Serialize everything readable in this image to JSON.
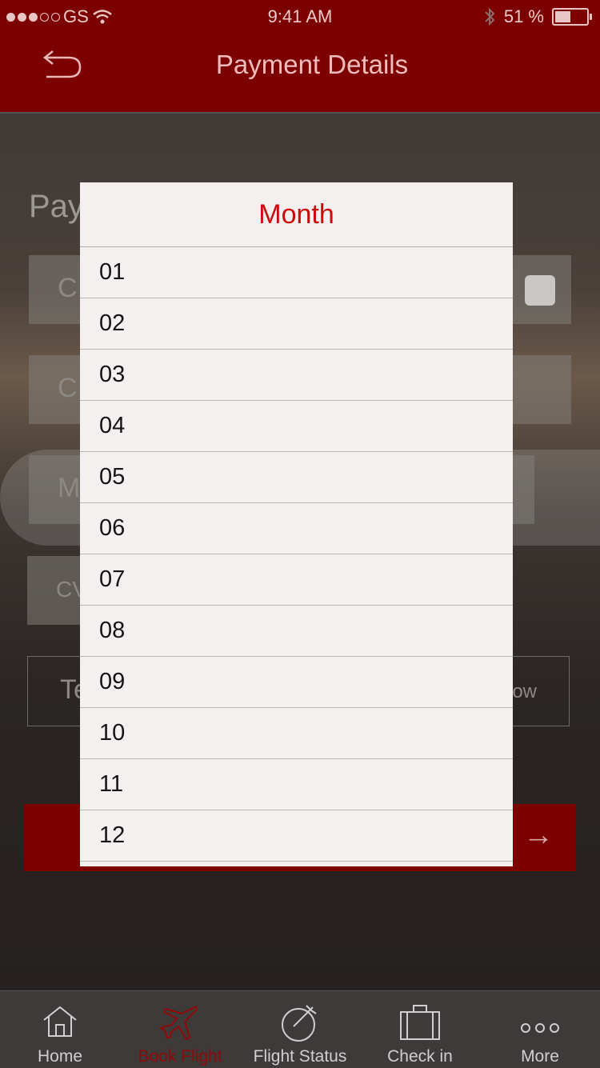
{
  "status": {
    "carrier": "GS",
    "time": "9:41 AM",
    "battery": "51 %",
    "battery_level": 0.51
  },
  "header": {
    "title": "Payment Details"
  },
  "form": {
    "section_label": "Pay",
    "card_partial": "C",
    "card2_partial": "C",
    "month_partial": "M",
    "cvv_partial": "CV",
    "terms_partial": "Te",
    "terms_right_partial": "ow"
  },
  "modal": {
    "title": "Month",
    "months": [
      "01",
      "02",
      "03",
      "04",
      "05",
      "06",
      "07",
      "08",
      "09",
      "10",
      "11",
      "12"
    ]
  },
  "tabs": [
    {
      "label": "Home",
      "icon": "home-icon"
    },
    {
      "label": "Book Flight",
      "icon": "plane-icon"
    },
    {
      "label": "Flight Status",
      "icon": "flight-status-icon"
    },
    {
      "label": "Check in",
      "icon": "suitcase-icon"
    },
    {
      "label": "More",
      "icon": "more-icon"
    }
  ],
  "colors": {
    "brand": "#7d0000",
    "accent": "#cc0a0a"
  }
}
